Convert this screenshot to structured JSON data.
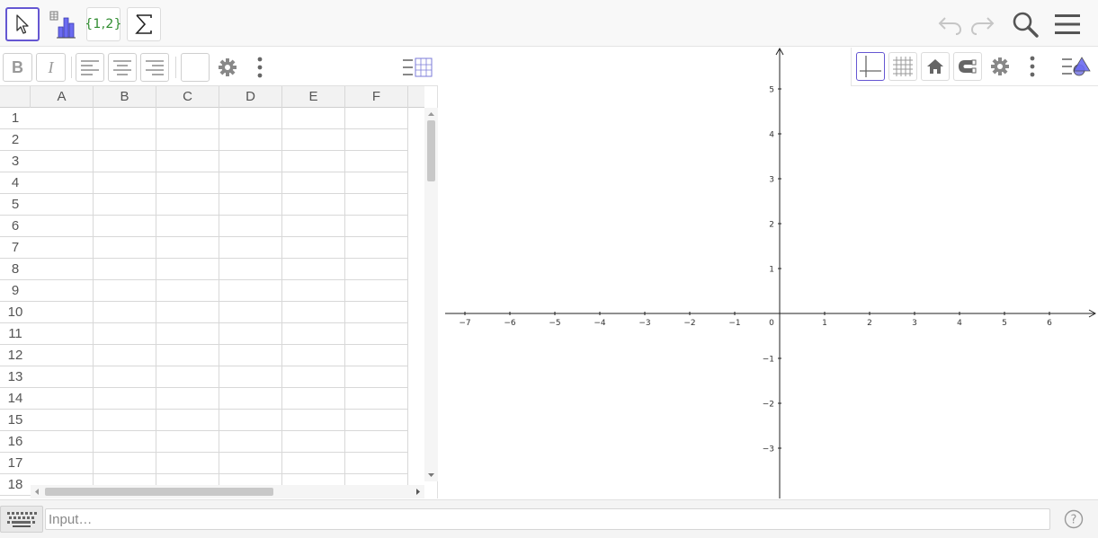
{
  "toolbar": {
    "tools": [
      {
        "name": "move-tool",
        "icon": "arrow-cursor-icon"
      },
      {
        "name": "one-variable-analysis-tool",
        "icon": "bar-chart-icon"
      },
      {
        "name": "create-list-tool",
        "icon": "set-braces-icon",
        "label": "{1,2}"
      },
      {
        "name": "sum-tool",
        "icon": "sigma-icon"
      }
    ],
    "right_icons": [
      "undo-icon",
      "redo-icon",
      "search-icon",
      "hamburger-menu-icon"
    ]
  },
  "style_bar": {
    "bold_label": "B",
    "italic_label": "I"
  },
  "spreadsheet": {
    "columns": [
      "A",
      "B",
      "C",
      "D",
      "E",
      "F"
    ],
    "rows": [
      "1",
      "2",
      "3",
      "4",
      "5",
      "6",
      "7",
      "8",
      "9",
      "10",
      "11",
      "12",
      "13",
      "14",
      "15",
      "16",
      "17",
      "18"
    ]
  },
  "graphics": {
    "x_ticks": [
      "−7",
      "−6",
      "−5",
      "−4",
      "−3",
      "−2",
      "−1",
      "0",
      "1",
      "2",
      "3",
      "4",
      "5",
      "6"
    ],
    "x_values": [
      -7,
      -6,
      -5,
      -4,
      -3,
      -2,
      -1,
      0,
      1,
      2,
      3,
      4,
      5,
      6
    ],
    "y_ticks": [
      "5",
      "4",
      "3",
      "2",
      "1",
      "−1",
      "−2",
      "−3"
    ],
    "y_values": [
      5,
      4,
      3,
      2,
      1,
      -1,
      -2,
      -3
    ],
    "x_range": [
      -7.4,
      7
    ],
    "y_range": [
      -4,
      5.9
    ],
    "grid": false
  },
  "input_bar": {
    "placeholder": "Input…"
  },
  "colors": {
    "accent": "#6557d2",
    "set_text": "#2e8b2e"
  }
}
